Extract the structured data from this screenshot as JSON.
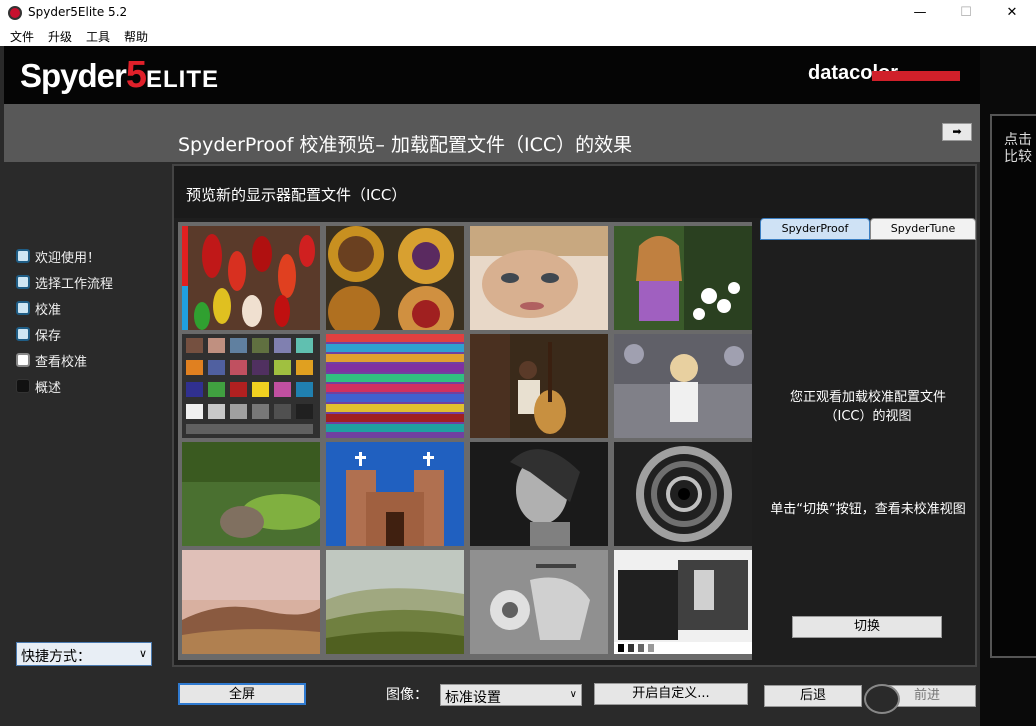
{
  "window": {
    "title": "Spyder5Elite 5.2",
    "minimize": "—",
    "maximize": "☐",
    "close": "✕"
  },
  "menu": [
    "文件",
    "升级",
    "工具",
    "帮助"
  ],
  "header": {
    "logo_main": "Spyder",
    "logo_num": "5",
    "logo_suffix": "ELITE",
    "brand": "datacolor",
    "brand_color": "#d0202a"
  },
  "banner": {
    "title": "SpyderProof 校准预览– 加载配置文件（ICC）的效果",
    "arrow": "➡"
  },
  "sidebar": {
    "items": [
      {
        "label": "欢迎使用！",
        "state": "blue"
      },
      {
        "label": "选择工作流程",
        "state": "blue"
      },
      {
        "label": "校准",
        "state": "blue"
      },
      {
        "label": "保存",
        "state": "blue"
      },
      {
        "label": "查看校准",
        "state": "white"
      },
      {
        "label": "概述",
        "state": "dark"
      }
    ],
    "shortcut": "快捷方式："
  },
  "main": {
    "title": "预览新的显示器配置文件（ICC）",
    "tabs": [
      "SpyderProof",
      "SpyderTune"
    ],
    "info1": "您正观看加载校准配置文件（ICC）的视图",
    "info2": "单击“切换”按钮，查看未校准视图",
    "switch": "切换"
  },
  "right_panel": {
    "text_line1": "点击",
    "text_line2": "比较"
  },
  "bottom": {
    "fullscreen": "全屏",
    "image_label": "图像：",
    "image_select": "标准设置",
    "custom": "开启自定义...",
    "back": "后退",
    "next": "前进"
  },
  "thumbnails": [
    "chili-peppers",
    "painted-plates",
    "woman-portrait",
    "girl-flowers",
    "color-checker",
    "textile-rolls",
    "cellist",
    "blonde-woman",
    "garden-urn",
    "adobe-church",
    "bw-portrait",
    "spiral-staircase",
    "sunset-hills",
    "tuscany-hills",
    "bw-scooter",
    "bw-test-chart"
  ]
}
